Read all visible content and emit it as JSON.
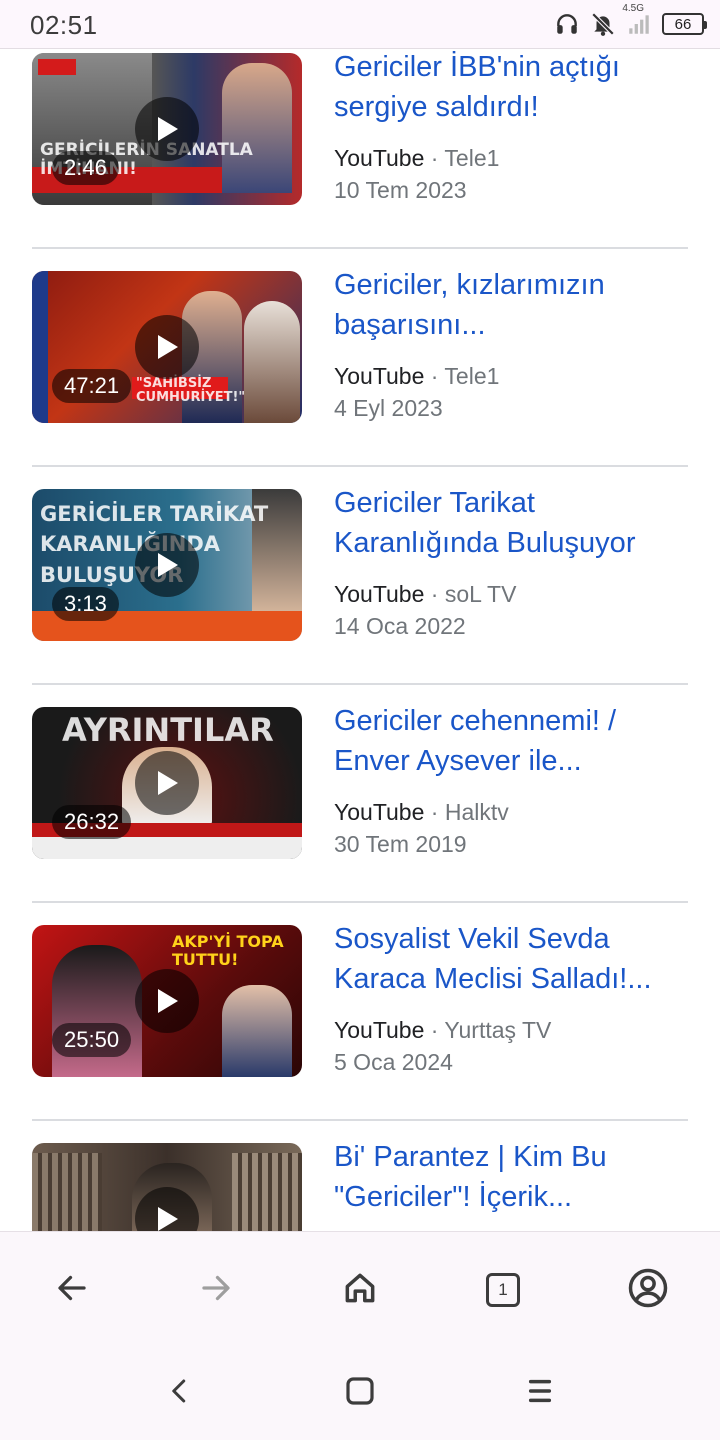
{
  "status_bar": {
    "time": "02:51",
    "network": "4.5G",
    "battery": "66",
    "icons": [
      "headphones-icon",
      "bell-off-icon",
      "signal-icon",
      "battery-icon"
    ]
  },
  "results": [
    {
      "title": "Gericiler İBB'nin açtığı sergiye saldırdı!",
      "source": "YouTube",
      "channel": "Tele1",
      "date": "10 Tem 2023",
      "duration": "2:46",
      "thumb_caption": "GERİCİLERİN SANATLA İMTİHANI!",
      "thumb_colors": [
        "#6b6b6b",
        "#c61d1d"
      ]
    },
    {
      "title": "Gericiler, kızlarımızın başarısını...",
      "source": "YouTube",
      "channel": "Tele1",
      "date": "4 Eyl 2023",
      "duration": "47:21",
      "thumb_caption": "\"SAHİBSİZ CUMHURİYET!\"",
      "thumb_colors": [
        "#b01c1c",
        "#1f2f6b"
      ]
    },
    {
      "title": "Gericiler Tarikat Karanlığında Buluşuyor",
      "source": "YouTube",
      "channel": "soL TV",
      "date": "14 Oca 2022",
      "duration": "3:13",
      "thumb_caption": "GERİCİLER TARİKAT KARANLIĞINDA BULUŞUYOR",
      "thumb_colors": [
        "#1d4e6e",
        "#e0541e"
      ]
    },
    {
      "title": "Gericiler cehennemi! / Enver Aysever ile...",
      "source": "YouTube",
      "channel": "Halktv",
      "date": "30 Tem 2019",
      "duration": "26:32",
      "thumb_caption": "AYRINTILAR",
      "thumb_colors": [
        "#1a1a1a",
        "#8b1010"
      ]
    },
    {
      "title": "Sosyalist Vekil Sevda Karaca Meclisi Salladı!...",
      "source": "YouTube",
      "channel": "Yurttaş TV",
      "date": "5 Oca 2024",
      "duration": "25:50",
      "thumb_caption": "AKP'Yİ TOPA TUTTU!",
      "thumb_colors": [
        "#a80f0f",
        "#3a0a0a"
      ]
    },
    {
      "title": "Bi' Parantez | Kim Bu \"Gericiler\"! İçerik...",
      "source": "",
      "channel": "",
      "date": "",
      "duration": "",
      "thumb_caption": "",
      "thumb_colors": [
        "#5a4a3e",
        "#2b2420"
      ]
    }
  ],
  "toolbar": {
    "back_icon": "arrow-left-icon",
    "forward_icon": "arrow-right-icon",
    "home_icon": "home-icon",
    "tab_count": "1",
    "account_icon": "account-icon"
  },
  "system_nav": {
    "back_icon": "nav-back-icon",
    "home_icon": "nav-home-icon",
    "recents_icon": "nav-recents-icon"
  },
  "colors": {
    "link": "#1a56c8",
    "meta": "#70757a",
    "divider": "#dadce0"
  }
}
